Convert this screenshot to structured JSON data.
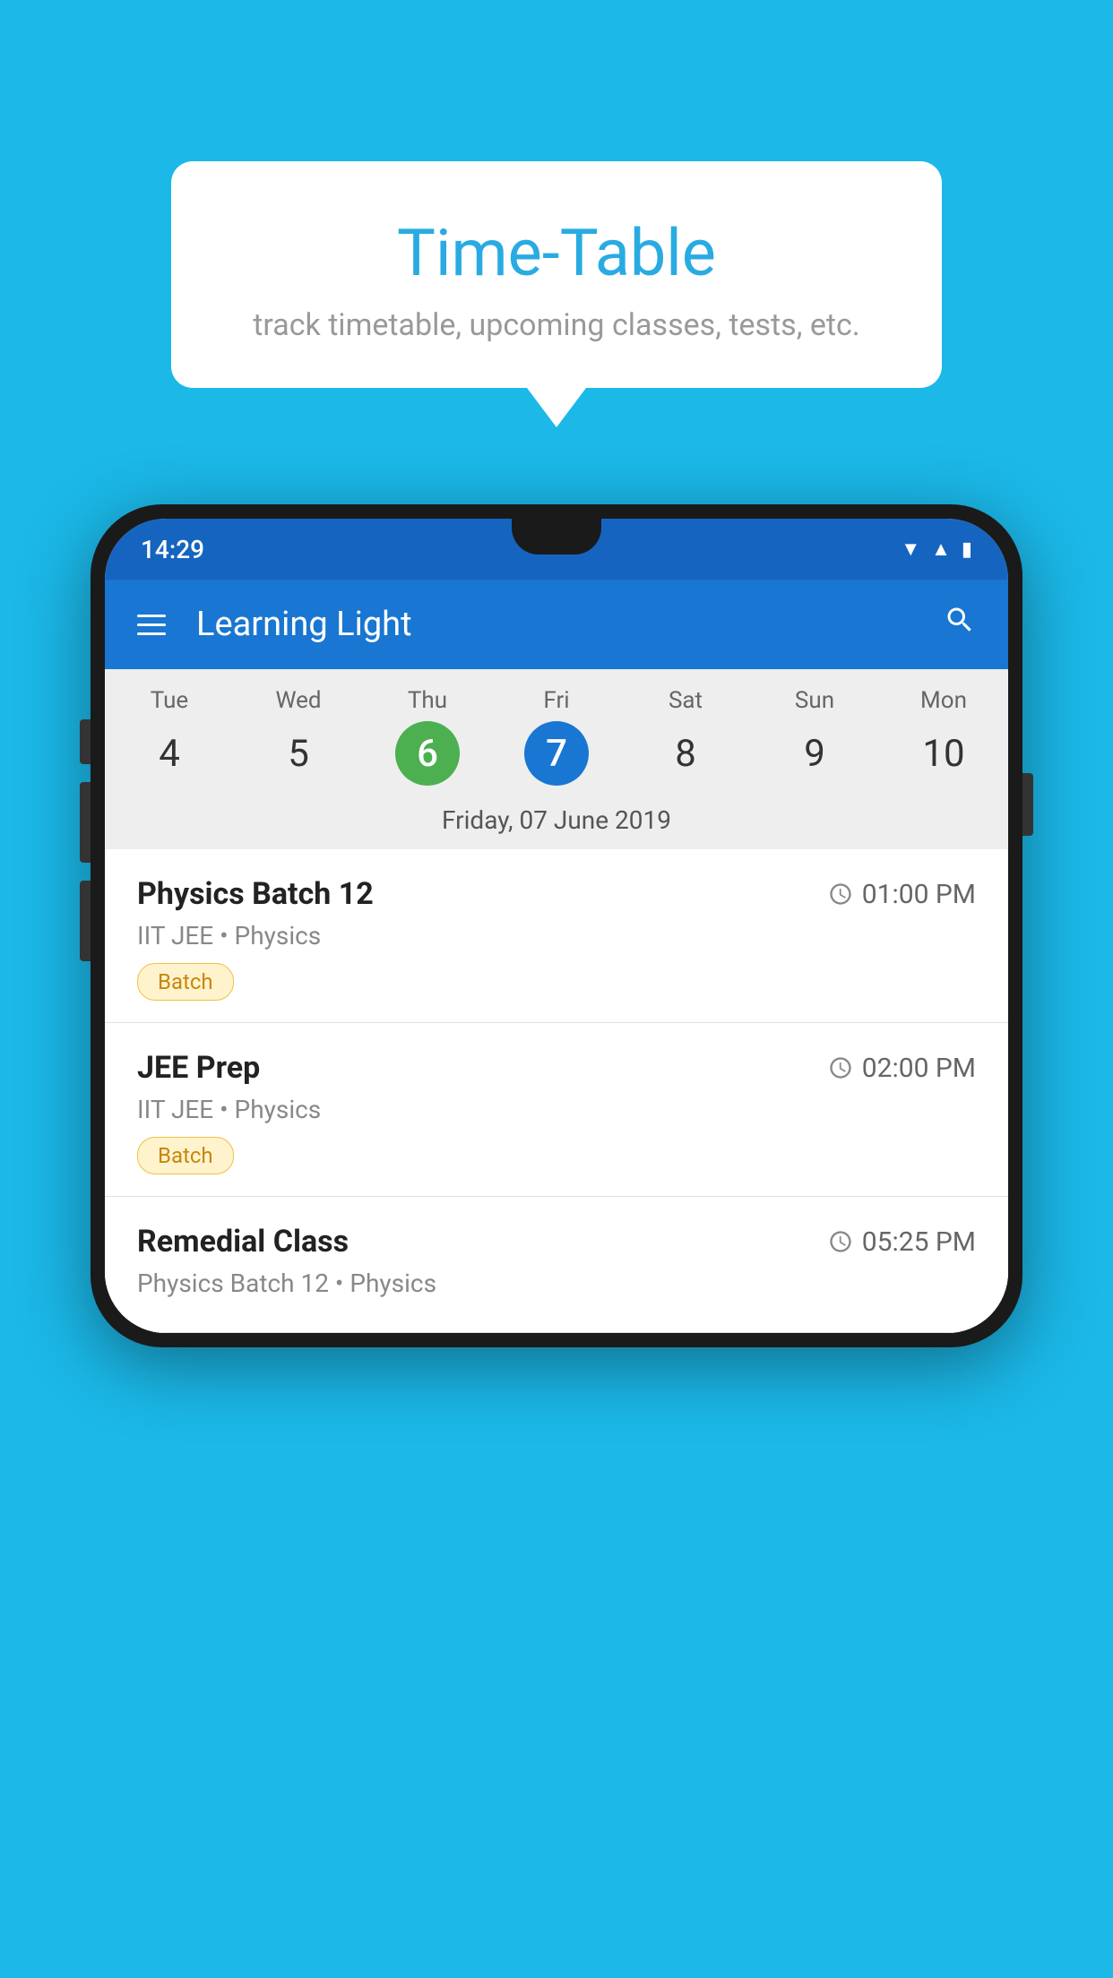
{
  "background_color": "#1BB8E8",
  "tooltip": {
    "title": "Time-Table",
    "subtitle": "track timetable, upcoming classes, tests, etc."
  },
  "app": {
    "name": "Learning Light",
    "status_time": "14:29"
  },
  "calendar": {
    "days": [
      {
        "name": "Tue",
        "num": "4",
        "state": "normal"
      },
      {
        "name": "Wed",
        "num": "5",
        "state": "normal"
      },
      {
        "name": "Thu",
        "num": "6",
        "state": "today"
      },
      {
        "name": "Fri",
        "num": "7",
        "state": "selected"
      },
      {
        "name": "Sat",
        "num": "8",
        "state": "normal"
      },
      {
        "name": "Sun",
        "num": "9",
        "state": "normal"
      },
      {
        "name": "Mon",
        "num": "10",
        "state": "normal"
      }
    ],
    "selected_date_label": "Friday, 07 June 2019"
  },
  "schedule": [
    {
      "title": "Physics Batch 12",
      "time": "01:00 PM",
      "meta": "IIT JEE • Physics",
      "badge": "Batch"
    },
    {
      "title": "JEE Prep",
      "time": "02:00 PM",
      "meta": "IIT JEE • Physics",
      "badge": "Batch"
    },
    {
      "title": "Remedial Class",
      "time": "05:25 PM",
      "meta": "Physics Batch 12 • Physics",
      "badge": null
    }
  ],
  "labels": {
    "hamburger_icon": "☰",
    "search_icon": "🔍",
    "clock_icon": "🕐"
  }
}
